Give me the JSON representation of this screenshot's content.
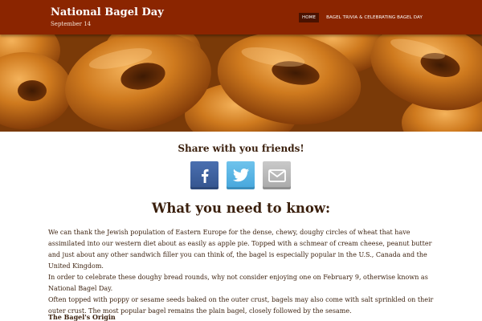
{
  "header": {
    "site_title": "National Bagel Day",
    "date": "September 14",
    "nav": [
      {
        "label": "HOME",
        "active": true
      },
      {
        "label": "BAGEL TRIVIA & CELEBRATING BAGEL DAY",
        "active": false
      }
    ]
  },
  "hero": {
    "image": "bagels-photo"
  },
  "share": {
    "title": "Share with you friends!",
    "buttons": [
      {
        "icon": "facebook-icon"
      },
      {
        "icon": "twitter-icon"
      },
      {
        "icon": "email-icon"
      }
    ]
  },
  "main": {
    "section_title": "What you need to know:",
    "paragraphs": [
      "We can thank the Jewish population of Eastern Europe for the dense, chewy, doughy circles of wheat that have assimilated into our western diet about as easily as apple pie. Topped with a schmear of cream cheese, peanut butter and just about any other sandwich filler you can think of, the bagel is especially popular in the U.S., Canada and the United Kingdom.",
      "In order to celebrate these doughy bread rounds, why not consider enjoying one on February 9, otherwise known as National Bagel Day.",
      "Often topped with poppy or sesame seeds baked on the outer crust, bagels may also come with salt sprinkled on their outer crust. The most popular bagel remains the plain bagel, closely followed by the sesame."
    ],
    "subheading": "The Bagel's Origin"
  },
  "colors": {
    "header_bg": "#8b2500",
    "text": "#3a1f0c",
    "facebook": "#3b5998",
    "twitter": "#55acee",
    "email": "#b5b5b5"
  }
}
